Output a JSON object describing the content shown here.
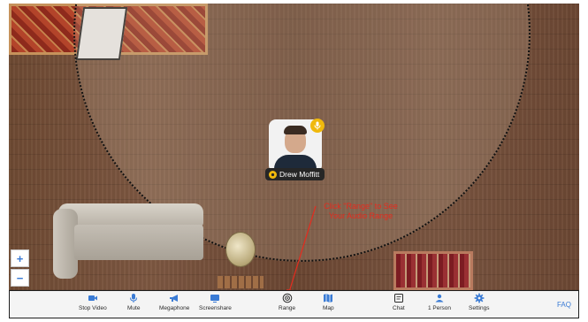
{
  "room": {
    "user": {
      "name": "Drew Moffitt"
    },
    "callout": {
      "line1": "Click \"Range\" to See",
      "line2": "Your Audio Range"
    },
    "zoom": {
      "in_label": "+",
      "out_label": "−"
    }
  },
  "toolbar": {
    "items": [
      {
        "label": "Stop Video",
        "icon": "video-camera-icon"
      },
      {
        "label": "Mute",
        "icon": "microphone-icon"
      },
      {
        "label": "Megaphone",
        "icon": "megaphone-icon"
      },
      {
        "label": "Screenshare",
        "icon": "screenshare-icon"
      },
      {
        "label": "Range",
        "icon": "range-icon"
      },
      {
        "label": "Map",
        "icon": "map-icon"
      },
      {
        "label": "Chat",
        "icon": "chat-icon"
      },
      {
        "label": "1 Person",
        "icon": "people-icon"
      },
      {
        "label": "Settings",
        "icon": "gear-icon"
      }
    ],
    "faq_label": "FAQ"
  },
  "colors": {
    "accent": "#3a7bd5",
    "callout": "#e62b1e",
    "badge": "#f0b90c"
  }
}
